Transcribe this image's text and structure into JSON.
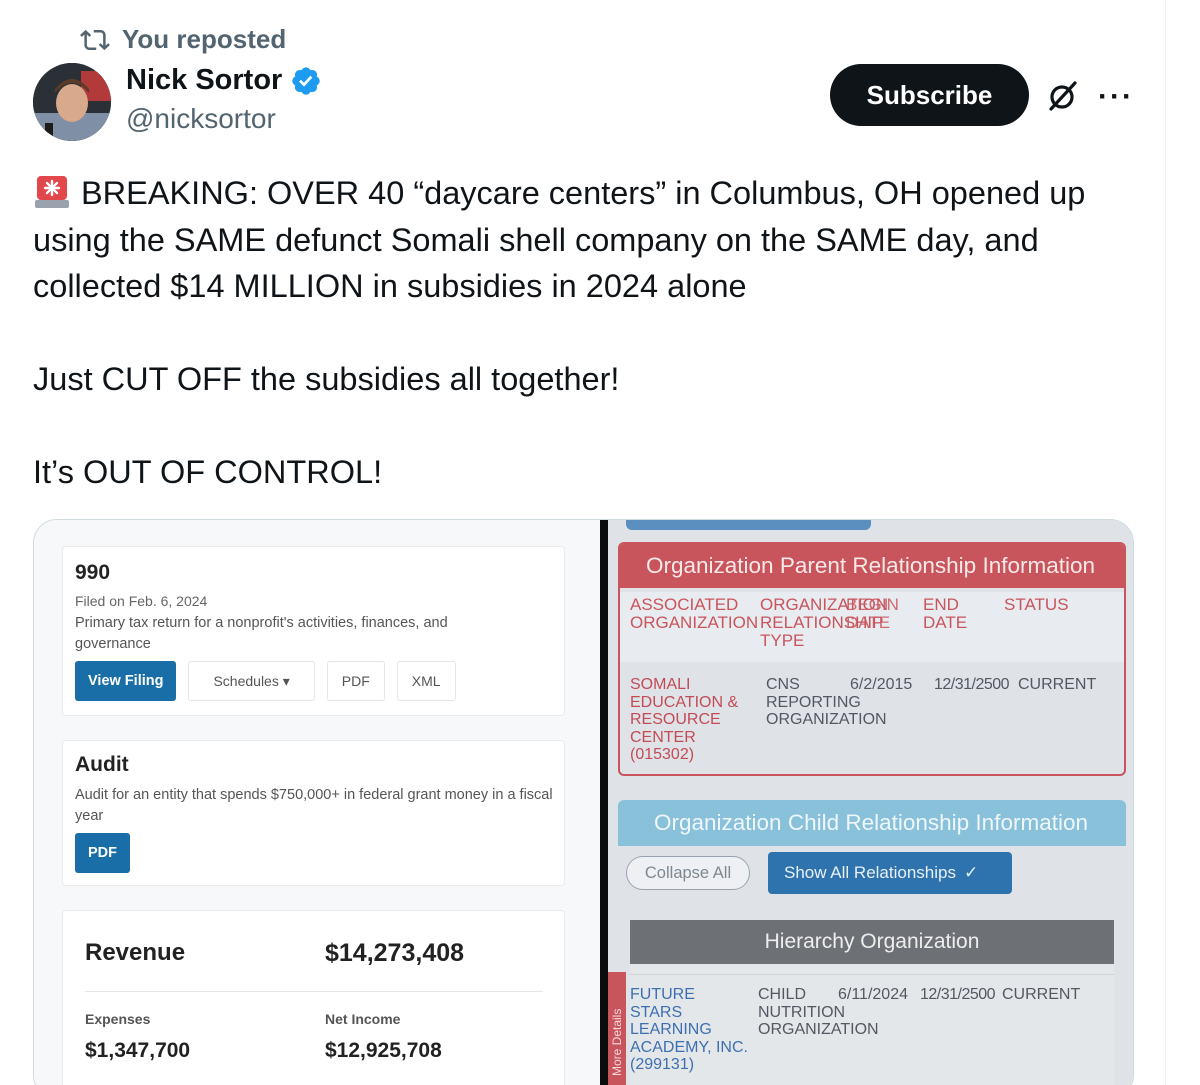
{
  "repost": {
    "label": "You reposted"
  },
  "author": {
    "name": "Nick Sortor",
    "handle": "@nicksortor"
  },
  "actions": {
    "subscribe_label": "Subscribe"
  },
  "tweet": {
    "line1": "BREAKING: OVER 40 “daycare centers” in Columbus, OH opened up using the SAME defunct Somali shell company on the SAME day, and collected $14 MILLION in subsidies in 2024 alone",
    "line2": "Just CUT OFF the subsidies all together!",
    "line3": "It’s OUT OF CONTROL!"
  },
  "media": {
    "form990": {
      "title": "990",
      "filed": "Filed on Feb. 6, 2024",
      "description": "Primary tax return for a nonprofit's activities, finances, and governance",
      "buttons": {
        "view": "View Filing",
        "schedules": "Schedules ▾",
        "pdf": "PDF",
        "xml": "XML"
      }
    },
    "audit": {
      "title": "Audit",
      "description": "Audit for an entity that spends $750,000+ in federal grant money in a fiscal year",
      "pdf": "PDF"
    },
    "revenue": {
      "label": "Revenue",
      "value": "$14,273,408",
      "expenses_label": "Expenses",
      "expenses_value": "$1,347,700",
      "net_label": "Net Income",
      "net_value": "$12,925,708"
    },
    "parent": {
      "header": "Organization Parent Relationship Information",
      "cols": {
        "assoc": "ASSOCIATED ORGANIZATION",
        "orgrel": "ORGANIZATION RELATIONSHIP TYPE",
        "begin": "BEGIN DATE",
        "end": "END DATE",
        "status": "STATUS"
      },
      "row": {
        "org": "SOMALI EDUCATION & RESOURCE CENTER (015302)",
        "type": "CNS REPORTING ORGANIZATION",
        "begin": "6/2/2015",
        "end": "12/31/2500",
        "status": "CURRENT"
      }
    },
    "child": {
      "header": "Organization Child Relationship Information",
      "collapse": "Collapse All",
      "show_all": "Show All Relationships",
      "hierarchy": "Hierarchy Organization",
      "more_tab": "More Details",
      "row": {
        "org": "FUTURE STARS LEARNING ACADEMY, INC. (299131)",
        "type": "CHILD NUTRITION ORGANIZATION",
        "begin": "6/11/2024",
        "end": "12/31/2500",
        "status": "CURRENT"
      }
    }
  },
  "colors": {
    "accent": "#1d9bf0",
    "text": "#0f1419",
    "muted": "#536471",
    "parent_red": "#c9555c",
    "child_blue": "#89c0da"
  }
}
